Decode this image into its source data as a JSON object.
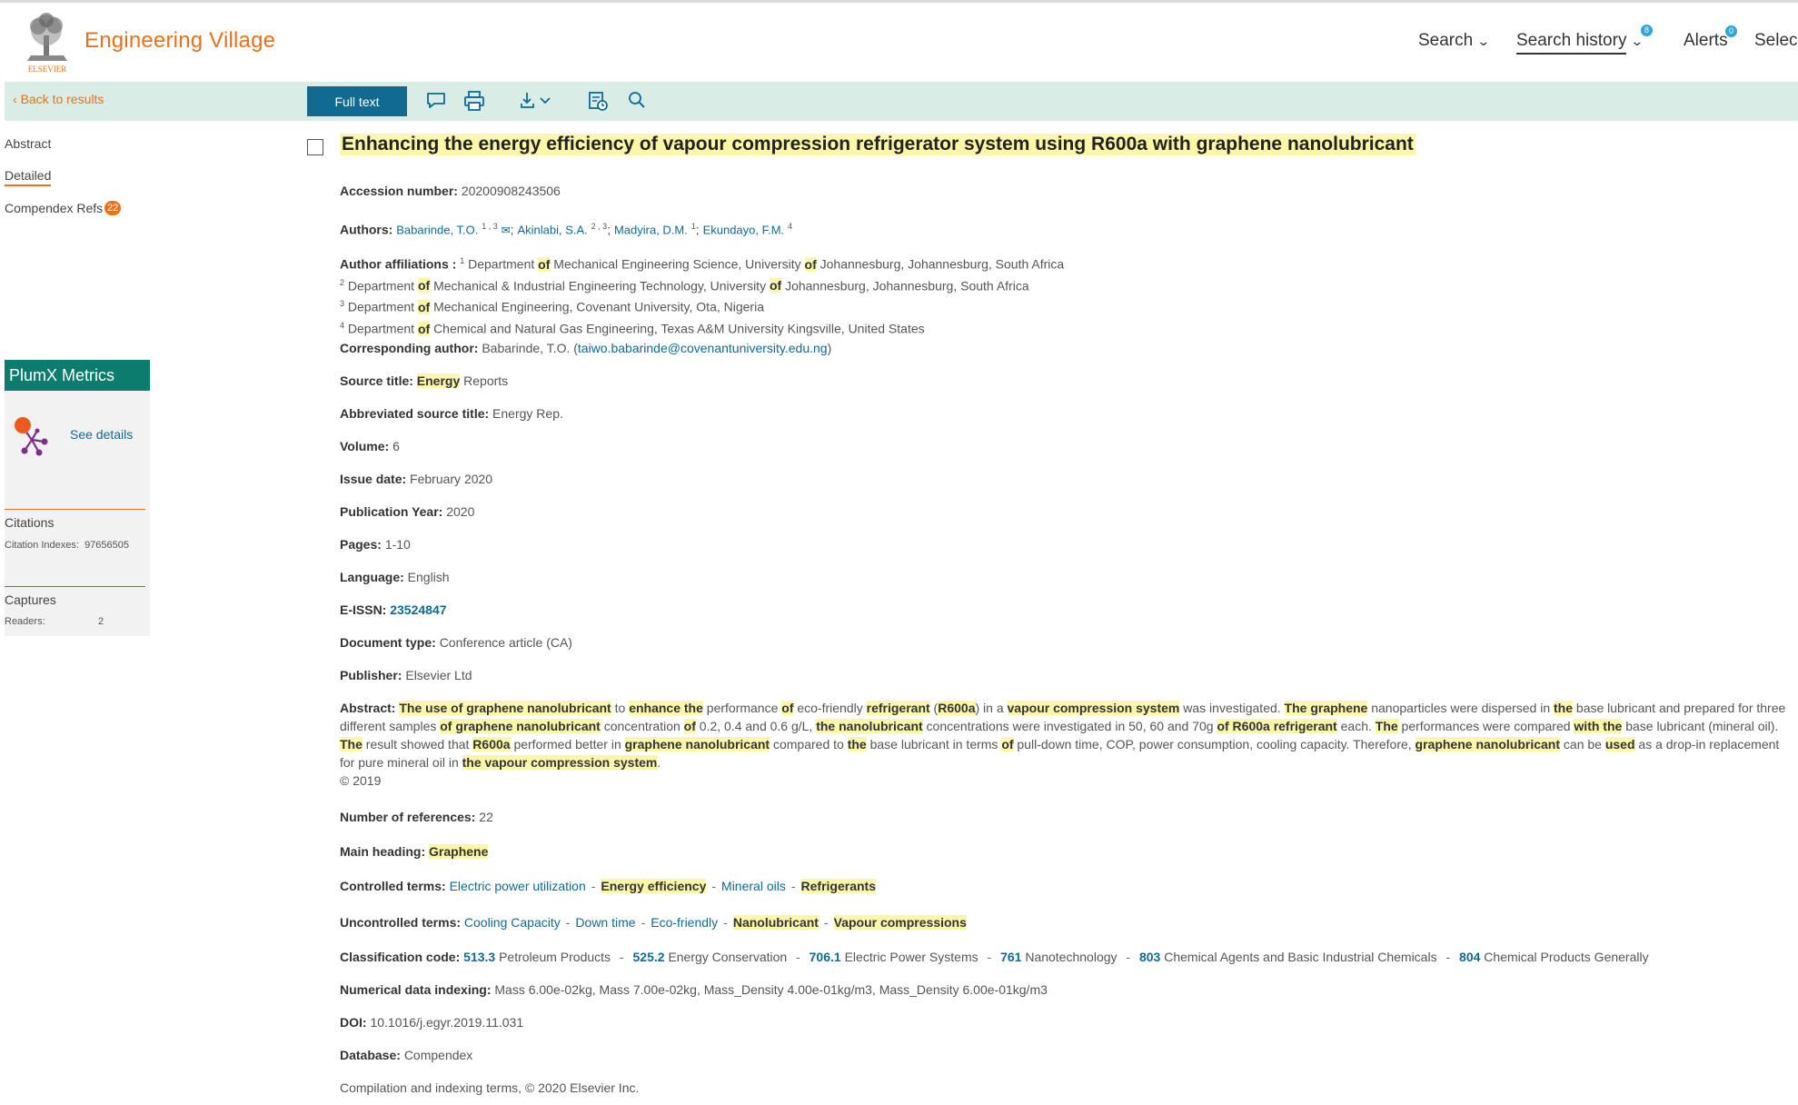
{
  "header": {
    "brand": "Engineering Village",
    "publisher_logo_text": "ELSEVIER",
    "nav": [
      {
        "label": "Search"
      },
      {
        "label": "Search history",
        "badge": "8"
      },
      {
        "label": "Alerts",
        "badge": "0"
      },
      {
        "label": "Select"
      }
    ]
  },
  "toolbar": {
    "back_label": "Back to results",
    "fulltext_label": "Full text",
    "icons": [
      "comment-icon",
      "print-icon",
      "download-icon",
      "save-to-folder-icon",
      "search-icon"
    ]
  },
  "sidebar": {
    "abstract_label": "Abstract",
    "detailed_label": "Detailed",
    "refs_label": "Compendex Refs",
    "refs_count": "22",
    "plumx_title": "PlumX Metrics",
    "see_details": "See details",
    "citations_title": "Citations",
    "citation_indexes_label": "Citation Indexes:",
    "citation_indexes_value": "97656505",
    "captures_title": "Captures",
    "readers_label": "Readers:",
    "readers_value": "2"
  },
  "record": {
    "title": "Enhancing the energy efficiency of vapour compression refrigerator system using R600a with graphene nanolubricant",
    "accession_label": "Accession number:",
    "accession_value": "20200908243506",
    "authors_label": "Authors:",
    "authors": [
      {
        "name": "Babarinde, T.O.",
        "sup": "1 , 3"
      },
      {
        "name": "Akinlabi, S.A.",
        "sup": "2 , 3"
      },
      {
        "name": "Madyira, D.M.",
        "sup": "1"
      },
      {
        "name": "Ekundayo, F.M.",
        "sup": "4"
      }
    ],
    "affiliations_label": "Author affiliations :",
    "affiliations": [
      {
        "num": "1",
        "pre": "Department ",
        "mid": "Mechanical Engineering Science, University ",
        "post": "Johannesburg, Johannesburg, South Africa"
      },
      {
        "num": "2",
        "pre": "Department ",
        "mid": "Mechanical & Industrial Engineering Technology, University ",
        "post": "Johannesburg, Johannesburg, South Africa"
      },
      {
        "num": "3",
        "pre": "Department ",
        "mid": "Mechanical Engineering, Covenant University, Ota, Nigeria",
        "post": ""
      },
      {
        "num": "4",
        "pre": "Department ",
        "mid": "Chemical and Natural Gas Engineering, Texas A&M University Kingsville, United States",
        "post": ""
      }
    ],
    "of_word": "of",
    "corresponding_label": "Corresponding author:",
    "corresponding_name": "Babarinde, T.O. (",
    "corresponding_email": "taiwo.babarinde@covenantuniversity.edu.ng",
    "corresponding_close": ")",
    "source_label": "Source title:",
    "source_hl": "Energy",
    "source_rest": " Reports",
    "abbrev_label": "Abbreviated source title:",
    "abbrev_value": "Energy Rep.",
    "volume_label": "Volume:",
    "volume_value": "6",
    "issue_label": "Issue date:",
    "issue_value": "February 2020",
    "pubyear_label": "Publication Year:",
    "pubyear_value": "2020",
    "pages_label": "Pages:",
    "pages_value": "1-10",
    "language_label": "Language:",
    "language_value": "English",
    "eissn_label": "E-ISSN:",
    "eissn_value": "23524847",
    "doctype_label": "Document type:",
    "doctype_value": "Conference article (CA)",
    "publisher_label": "Publisher:",
    "publisher_value": "Elsevier Ltd",
    "abstract_label": "Abstract:",
    "abstract_copyright": "© 2019",
    "numrefs_label": "Number of references:",
    "numrefs_value": "22",
    "mainheading_label": "Main heading:",
    "mainheading_value": "Graphene",
    "controlled_label": "Controlled terms:",
    "controlled_terms": [
      {
        "text": "Electric power utilization",
        "hl": false
      },
      {
        "text": "Energy efficiency",
        "hl": true
      },
      {
        "text": "Mineral oils",
        "hl": false
      },
      {
        "text": "Refrigerants",
        "hl": true
      }
    ],
    "uncontrolled_label": "Uncontrolled terms:",
    "uncontrolled_terms": [
      {
        "text": "Cooling Capacity",
        "hl": false
      },
      {
        "text": "Down time",
        "hl": false
      },
      {
        "text": "Eco-friendly",
        "hl": false
      },
      {
        "text": "Nanolubricant",
        "hl": true
      },
      {
        "text": "Vapour compressions",
        "hl": true
      }
    ],
    "classification_label": "Classification code:",
    "classification": [
      {
        "code": "513.3",
        "desc": "Petroleum Products"
      },
      {
        "code": "525.2",
        "desc": "Energy Conservation"
      },
      {
        "code": "706.1",
        "desc": "Electric Power Systems"
      },
      {
        "code": "761",
        "desc": "Nanotechnology"
      },
      {
        "code": "803",
        "desc": "Chemical Agents and Basic Industrial Chemicals"
      },
      {
        "code": "804",
        "desc": "Chemical Products Generally"
      }
    ],
    "numerical_label": "Numerical data indexing:",
    "numerical_value": "Mass 6.00e-02kg, Mass 7.00e-02kg, Mass_Density 4.00e-01kg/m3, Mass_Density 6.00e-01kg/m3",
    "doi_label": "DOI:",
    "doi_value": "10.1016/j.egyr.2019.11.031",
    "database_label": "Database:",
    "database_value": "Compendex",
    "compilation": "Compilation and indexing terms, © 2020 Elsevier Inc."
  },
  "abstract_segments": [
    {
      "t": "The use of graphene nanolubricant",
      "h": true
    },
    {
      "t": " to ",
      "h": false
    },
    {
      "t": "enhance the",
      "h": true
    },
    {
      "t": " performance ",
      "h": false
    },
    {
      "t": "of",
      "h": true
    },
    {
      "t": " eco-friendly ",
      "h": false
    },
    {
      "t": "refrigerant",
      "h": true
    },
    {
      "t": " (",
      "h": false
    },
    {
      "t": "R600a",
      "h": true
    },
    {
      "t": ") in a ",
      "h": false
    },
    {
      "t": "vapour compression system",
      "h": true
    },
    {
      "t": " was investigated. ",
      "h": false
    },
    {
      "t": "The graphene",
      "h": true
    },
    {
      "t": " nanoparticles were dispersed in ",
      "h": false
    },
    {
      "t": "the",
      "h": true
    },
    {
      "t": " base lubricant and prepared for three different samples ",
      "h": false
    },
    {
      "t": "of graphene nanolubricant",
      "h": true
    },
    {
      "t": " concentration ",
      "h": false
    },
    {
      "t": "of",
      "h": true
    },
    {
      "t": " 0.2, 0.4 and 0.6 g/L, ",
      "h": false
    },
    {
      "t": "the nanolubricant",
      "h": true
    },
    {
      "t": " concentrations were investigated in 50, 60 and 70g ",
      "h": false
    },
    {
      "t": "of R600a refrigerant",
      "h": true
    },
    {
      "t": " each. ",
      "h": false
    },
    {
      "t": "The",
      "h": true
    },
    {
      "t": " performances were compared ",
      "h": false
    },
    {
      "t": "with the",
      "h": true
    },
    {
      "t": " base lubricant (mineral oil). ",
      "h": false
    },
    {
      "t": "The",
      "h": true
    },
    {
      "t": " result showed that ",
      "h": false
    },
    {
      "t": "R600a",
      "h": true
    },
    {
      "t": " performed better in ",
      "h": false
    },
    {
      "t": "graphene nanolubricant",
      "h": true
    },
    {
      "t": " compared to ",
      "h": false
    },
    {
      "t": "the",
      "h": true
    },
    {
      "t": " base lubricant in terms ",
      "h": false
    },
    {
      "t": "of",
      "h": true
    },
    {
      "t": " pull-down time, COP, power consumption, cooling capacity. Therefore, ",
      "h": false
    },
    {
      "t": "graphene nanolubricant",
      "h": true
    },
    {
      "t": " can be ",
      "h": false
    },
    {
      "t": "used",
      "h": true
    },
    {
      "t": " as a drop-in replacement for pure mineral oil in ",
      "h": false
    },
    {
      "t": "the vapour compression system",
      "h": true
    },
    {
      "t": ".",
      "h": false
    }
  ],
  "colors": {
    "brand_orange": "#e9711c",
    "link_blue": "#106a92",
    "toolbar_bg": "#d9ece6",
    "plumx_green": "#0b7c6e",
    "highlight_yellow": "#fbf7a8",
    "badge_blue": "#32a6d8"
  }
}
